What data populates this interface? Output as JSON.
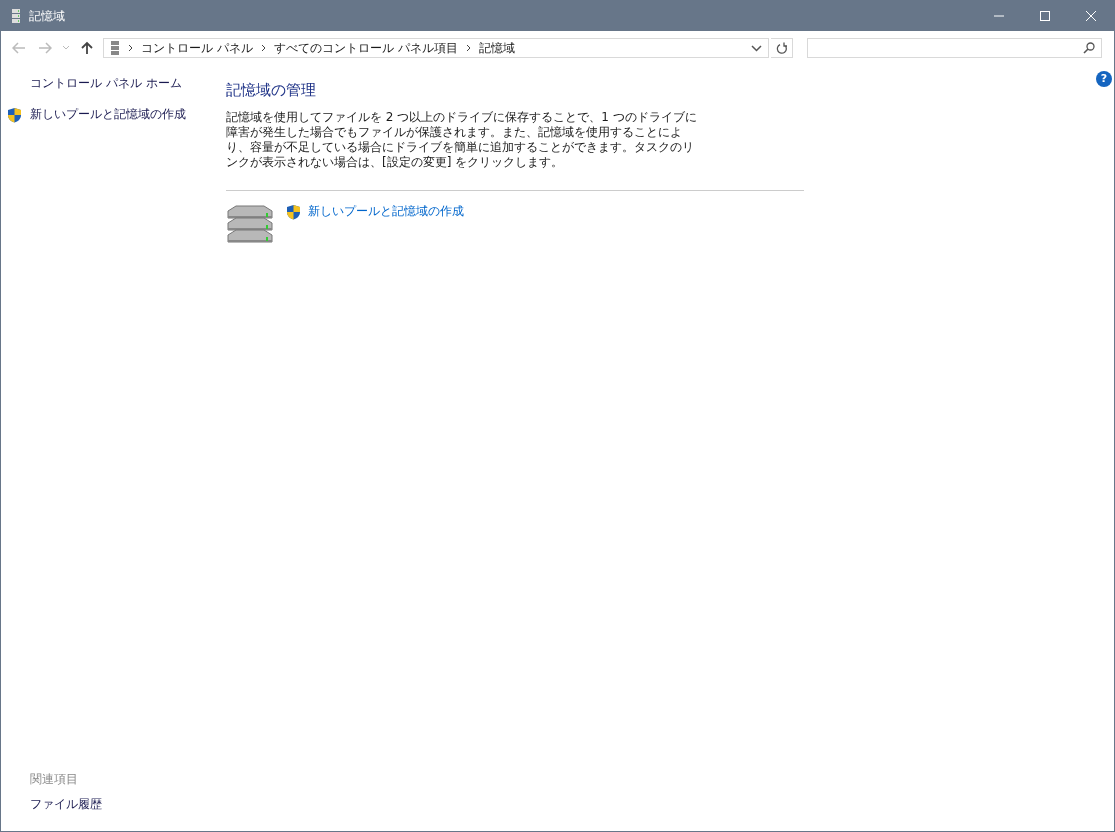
{
  "window": {
    "title": "記憶域"
  },
  "nav_buttons": [
    {
      "kind": "back",
      "disabled": true
    },
    {
      "kind": "forward",
      "disabled": true
    },
    {
      "kind": "recent",
      "disabled": true
    },
    {
      "kind": "up",
      "disabled": false
    }
  ],
  "breadcrumbs": [
    "コントロール パネル",
    "すべてのコントロール パネル項目",
    "記憶域"
  ],
  "sidebar": {
    "items": [
      {
        "label": "コントロール パネル ホーム",
        "shield": false
      },
      {
        "label": "新しいプールと記憶域の作成",
        "shield": true
      }
    ]
  },
  "main": {
    "heading": "記憶域の管理",
    "description": "記憶域を使用してファイルを 2 つ以上のドライブに保存することで、1 つのドライブに障害が発生した場合でもファイルが保護されます。また、記憶域を使用することにより、容量が不足している場合にドライブを簡単に追加することができます。タスクのリンクが表示されない場合は、[設定の変更] をクリックします。",
    "tasks": [
      {
        "label": "新しいプールと記憶域の作成",
        "shield": true
      }
    ]
  },
  "related": {
    "heading": "関連項目",
    "items": [
      "ファイル履歴"
    ]
  },
  "help": "?"
}
